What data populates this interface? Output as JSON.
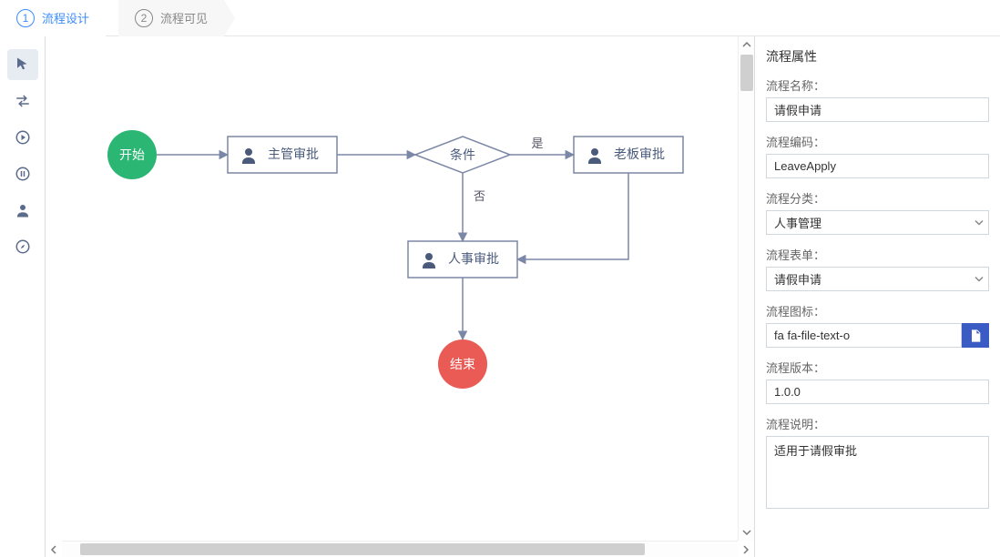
{
  "tabs": {
    "design": {
      "num": "1",
      "label": "流程设计"
    },
    "visibility": {
      "num": "2",
      "label": "流程可见"
    }
  },
  "palette": {
    "tools": [
      "pointer",
      "swap",
      "play",
      "pause",
      "user",
      "compass"
    ]
  },
  "diagram": {
    "start": "开始",
    "end": "结束",
    "manager_approval": "主管审批",
    "boss_approval": "老板审批",
    "hr_approval": "人事审批",
    "condition": "条件",
    "yes": "是",
    "no": "否"
  },
  "props": {
    "title": "流程属性",
    "name_label": "流程名称：",
    "name_value": "请假申请",
    "code_label": "流程编码：",
    "code_value": "LeaveApply",
    "category_label": "流程分类：",
    "category_value": "人事管理",
    "form_label": "流程表单：",
    "form_value": "请假申请",
    "icon_label": "流程图标：",
    "icon_value": "fa fa-file-text-o",
    "version_label": "流程版本：",
    "version_value": "1.0.0",
    "desc_label": "流程说明：",
    "desc_value": "适用于请假审批"
  }
}
